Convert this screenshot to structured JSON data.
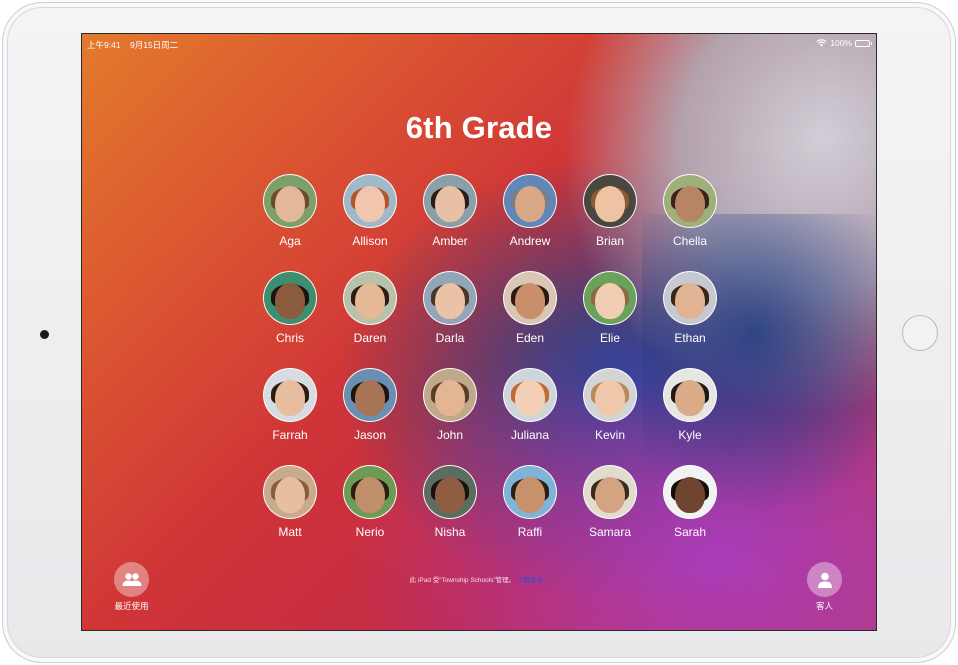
{
  "status_bar": {
    "time": "上午9:41",
    "date": "9月15日周二",
    "battery": "100%"
  },
  "title": "6th Grade",
  "students": [
    {
      "name": "Aga",
      "skin": "#e2b79a",
      "hair": "#6b4a2e",
      "bg": "#7da06a"
    },
    {
      "name": "Allison",
      "skin": "#f0c7ae",
      "hair": "#b5542c",
      "bg": "#9fb9c9"
    },
    {
      "name": "Amber",
      "skin": "#e8c0a6",
      "hair": "#2a1d18",
      "bg": "#8aa0a8"
    },
    {
      "name": "Andrew",
      "skin": "#d9a987",
      "hair": "#7b7f86",
      "bg": "#5f87b8"
    },
    {
      "name": "Brian",
      "skin": "#edc3a3",
      "hair": "#8a5a35",
      "bg": "#4a4740"
    },
    {
      "name": "Chella",
      "skin": "#b88466",
      "hair": "#3a2418",
      "bg": "#9eb07a"
    },
    {
      "name": "Chris",
      "skin": "#8b5b3d",
      "hair": "#1c1410",
      "bg": "#3d8f6f"
    },
    {
      "name": "Daren",
      "skin": "#e5b896",
      "hair": "#2c1e16",
      "bg": "#b7c2a9"
    },
    {
      "name": "Darla",
      "skin": "#e9c2a8",
      "hair": "#4a3426",
      "bg": "#93a6b7"
    },
    {
      "name": "Eden",
      "skin": "#c98e6b",
      "hair": "#2a1a12",
      "bg": "#d9c6b4"
    },
    {
      "name": "Elie",
      "skin": "#f1cdb4",
      "hair": "#8c6a45",
      "bg": "#6aa25c"
    },
    {
      "name": "Ethan",
      "skin": "#e0b393",
      "hair": "#3a2518",
      "bg": "#c6c9cf"
    },
    {
      "name": "Farrah",
      "skin": "#e6bd9f",
      "hair": "#2a1c15",
      "bg": "#d7dce2"
    },
    {
      "name": "Jason",
      "skin": "#a77455",
      "hair": "#1e140f",
      "bg": "#6a8fb3"
    },
    {
      "name": "John",
      "skin": "#e3b593",
      "hair": "#5a3d27",
      "bg": "#bfa98a"
    },
    {
      "name": "Juliana",
      "skin": "#f3cfb7",
      "hair": "#c26a36",
      "bg": "#cfd6db"
    },
    {
      "name": "Kevin",
      "skin": "#efc8ab",
      "hair": "#b98a52",
      "bg": "#d2d4d6"
    },
    {
      "name": "Kyle",
      "skin": "#d9ab88",
      "hair": "#1f1a16",
      "bg": "#e6e6e2"
    },
    {
      "name": "Matt",
      "skin": "#e7bfa0",
      "hair": "#8a5c3b",
      "bg": "#c7ab8c"
    },
    {
      "name": "Nerio",
      "skin": "#c08f6c",
      "hair": "#2b1d14",
      "bg": "#6f9a55"
    },
    {
      "name": "Nisha",
      "skin": "#8f5e42",
      "hair": "#1b120d",
      "bg": "#5b6d5f"
    },
    {
      "name": "Raffi",
      "skin": "#c7916c",
      "hair": "#2c1f17",
      "bg": "#7fb3d8"
    },
    {
      "name": "Samara",
      "skin": "#d4a482",
      "hair": "#3a2a1e",
      "bg": "#e2dccf"
    },
    {
      "name": "Sarah",
      "skin": "#6f4431",
      "hair": "#140e0b",
      "bg": "#f2f2f2"
    }
  ],
  "recent_button": {
    "label": "最近使用",
    "icon": "people-icon"
  },
  "guest_button": {
    "label": "客人",
    "icon": "person-icon"
  },
  "managed_note": {
    "text": "此 iPad 受“Township Schools”管理。",
    "link": "了解更多..."
  },
  "colors": {
    "wallpaper_top": "#e27a2c",
    "wallpaper_mid": "#cf3437",
    "wallpaper_blue": "#0a4696",
    "wallpaper_purple": "#aa3cbe",
    "link": "#2a4fe0"
  }
}
